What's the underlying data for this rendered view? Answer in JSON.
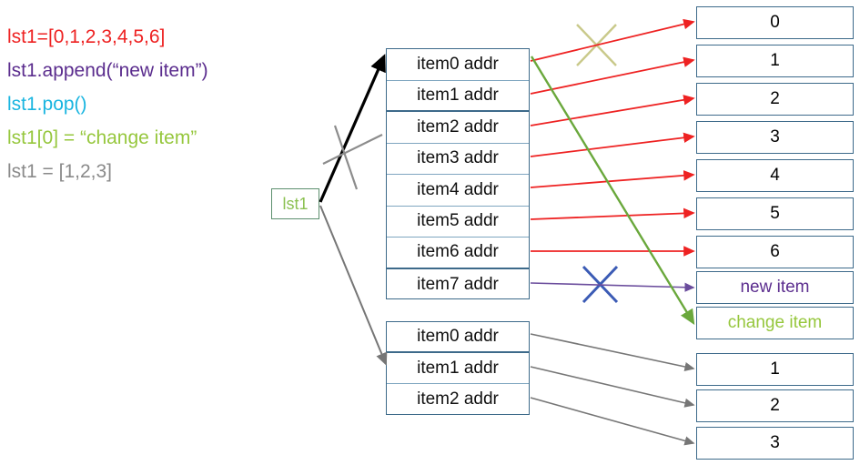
{
  "code": {
    "lines": [
      {
        "text": "lst1=[0,1,2,3,4,5,6]",
        "color": "#ee2222"
      },
      {
        "text": "lst1.append(“new item”)",
        "color": "#5b2d8e"
      },
      {
        "text": "lst1.pop()",
        "color": "#19b5e0"
      },
      {
        "text": "lst1[0] = “change item”",
        "color": "#96c73d"
      },
      {
        "text": "lst1 = [1,2,3]",
        "color": "#8a8a8a"
      }
    ]
  },
  "variable": {
    "label": "lst1"
  },
  "pointer_table_1": {
    "rows": [
      "item0 addr",
      "item1 addr",
      "item2 addr",
      "item3 addr",
      "item4 addr",
      "item5 addr",
      "item6 addr",
      "item7 addr"
    ]
  },
  "pointer_table_2": {
    "rows": [
      "item0 addr",
      "item1 addr",
      "item2 addr"
    ]
  },
  "value_boxes": [
    {
      "text": "0",
      "color": "#111111"
    },
    {
      "text": "1",
      "color": "#111111"
    },
    {
      "text": "2",
      "color": "#111111"
    },
    {
      "text": "3",
      "color": "#111111"
    },
    {
      "text": "4",
      "color": "#111111"
    },
    {
      "text": "5",
      "color": "#111111"
    },
    {
      "text": "6",
      "color": "#111111"
    },
    {
      "text": "new item",
      "color": "#5b2d8e"
    },
    {
      "text": "change item",
      "color": "#96c73d"
    },
    {
      "text": "1",
      "color": "#111111"
    },
    {
      "text": "2",
      "color": "#111111"
    },
    {
      "text": "3",
      "color": "#111111"
    }
  ],
  "colors": {
    "red_arrow": "#ee2222",
    "purple_arrow": "#6a4c9c",
    "green_arrow": "#6aa83c",
    "grey_arrow": "#767676",
    "black_arrow": "#000000",
    "blue_x": "#3b5bb5",
    "khaki_x": "#c9c98a",
    "grey_x": "#8c8c8c",
    "box_border": "#3d6a8a",
    "var_border": "#5c8f6e"
  }
}
